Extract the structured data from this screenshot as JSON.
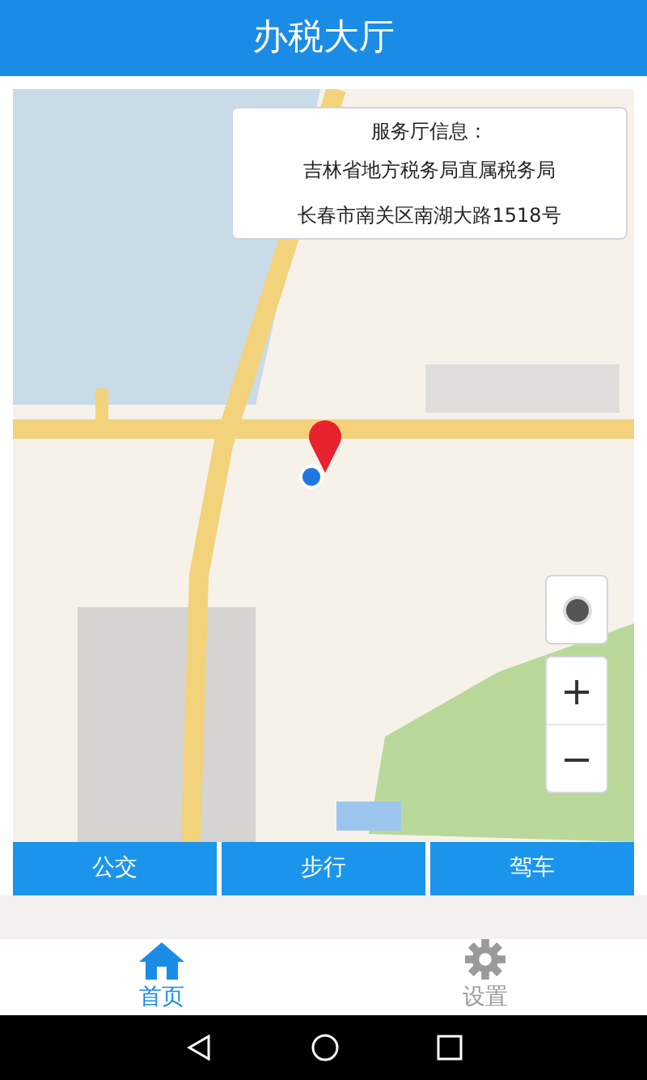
{
  "header": {
    "title": "办税大厅"
  },
  "info_card": {
    "title": "服务厅信息：",
    "lines": [
      "吉林省地方税务局直属税务局",
      "长春市南关区南湖大路1518号"
    ]
  },
  "map_controls": {
    "zoom_in": "+",
    "zoom_out": "−"
  },
  "route_buttons": [
    "公交",
    "步行",
    "驾车"
  ],
  "tabs": [
    {
      "label": "首页",
      "kind": "home",
      "selected": true
    },
    {
      "label": "设置",
      "kind": "settings",
      "selected": false
    }
  ]
}
